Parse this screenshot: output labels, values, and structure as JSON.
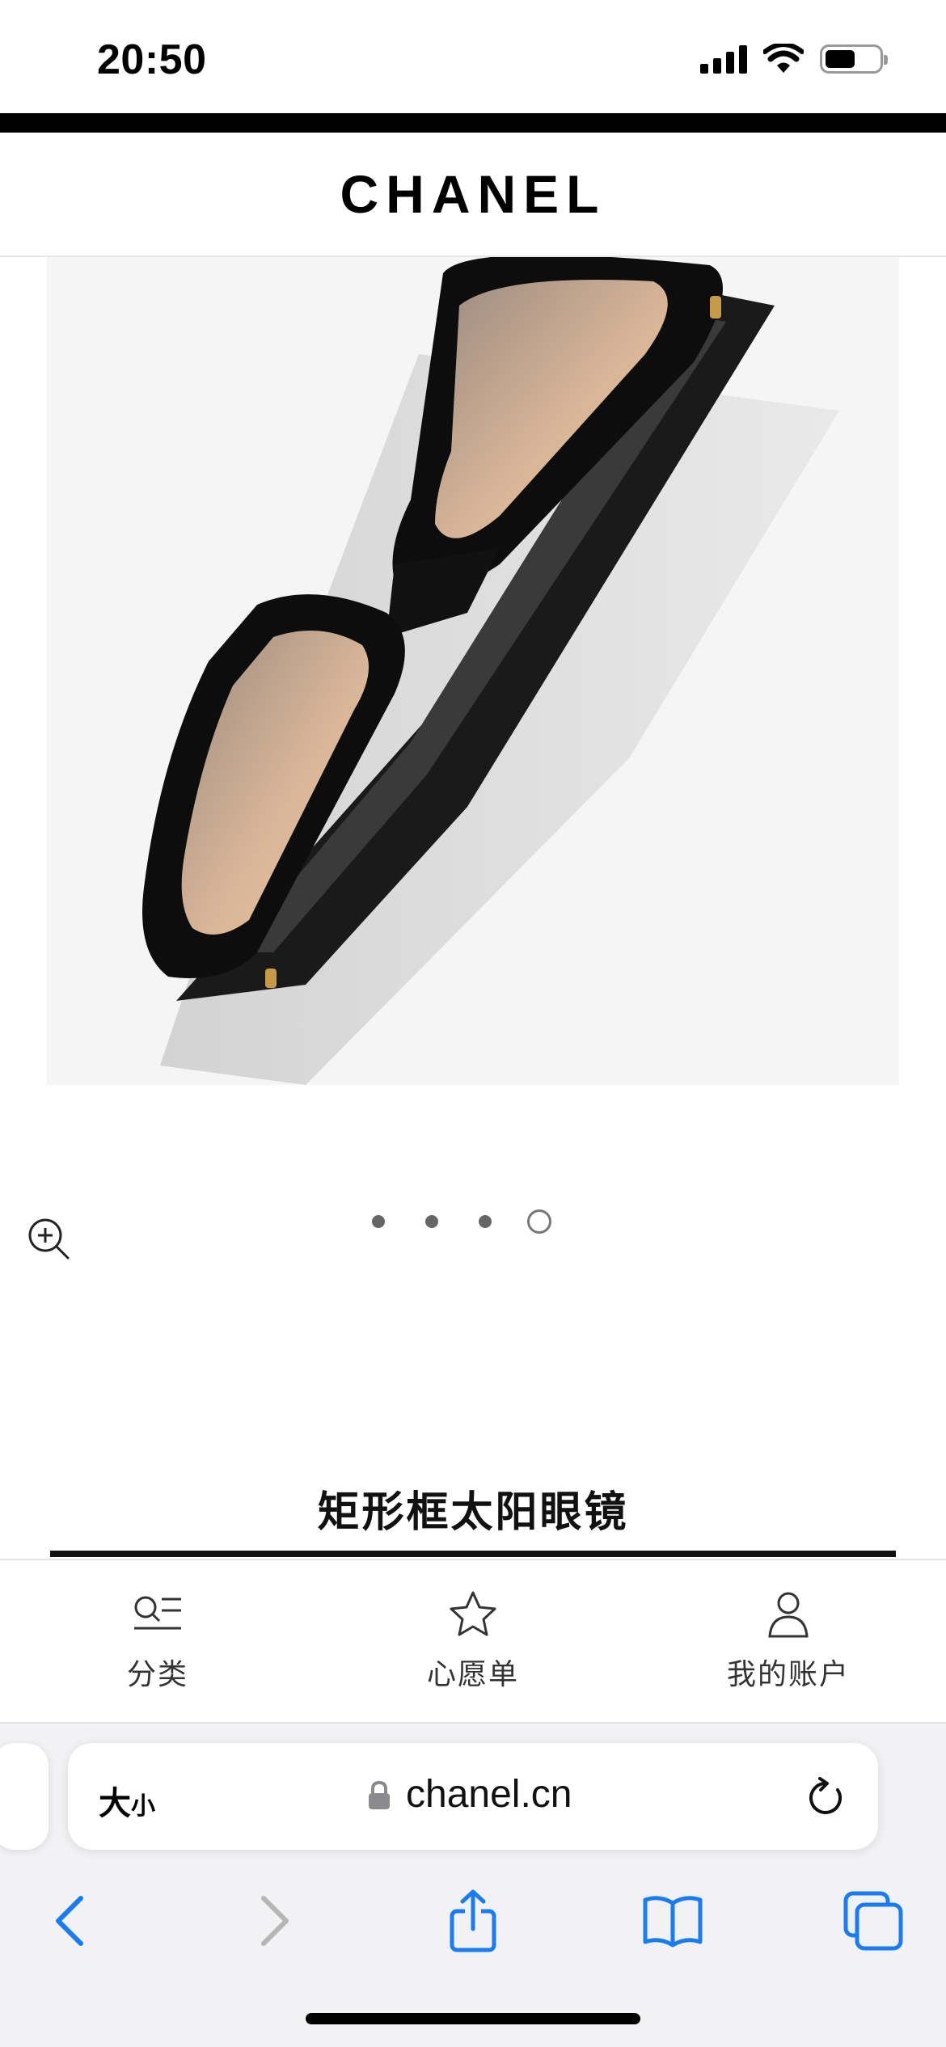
{
  "status_bar": {
    "time": "20:50",
    "battery_level": 0.56
  },
  "header": {
    "brand": "CHANEL"
  },
  "carousel": {
    "total_slides": 4,
    "active_slide": 4
  },
  "product": {
    "title": "矩形框太阳眼镜"
  },
  "tab_bar": {
    "items": [
      {
        "label": "分类",
        "icon": "category-list-icon"
      },
      {
        "label": "心愿单",
        "icon": "star-icon"
      },
      {
        "label": "我的账户",
        "icon": "person-icon"
      }
    ]
  },
  "browser": {
    "text_size_label_big": "大",
    "text_size_label_small": "小",
    "url": "chanel.cn"
  },
  "colors": {
    "accent_blue": "#1a7cf5",
    "disabled_gray": "#b5b5b5"
  }
}
